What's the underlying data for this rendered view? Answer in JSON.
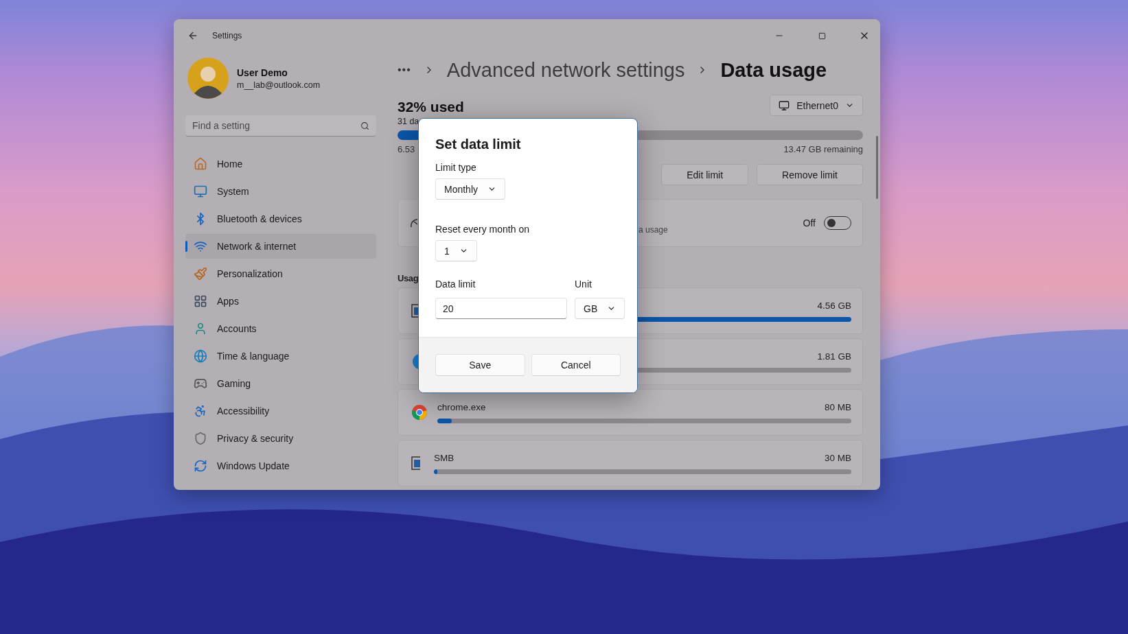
{
  "window": {
    "title": "Settings"
  },
  "profile": {
    "name": "User Demo",
    "email": "m__lab@outlook.com"
  },
  "search": {
    "placeholder": "Find a setting"
  },
  "sidebar": {
    "items": [
      {
        "label": "Home",
        "kind": "home",
        "selected": false
      },
      {
        "label": "System",
        "kind": "system",
        "selected": false
      },
      {
        "label": "Bluetooth & devices",
        "kind": "bluetooth",
        "selected": false
      },
      {
        "label": "Network & internet",
        "kind": "network",
        "selected": true
      },
      {
        "label": "Personalization",
        "kind": "brush",
        "selected": false
      },
      {
        "label": "Apps",
        "kind": "apps",
        "selected": false
      },
      {
        "label": "Accounts",
        "kind": "accounts",
        "selected": false
      },
      {
        "label": "Time & language",
        "kind": "time",
        "selected": false
      },
      {
        "label": "Gaming",
        "kind": "gaming",
        "selected": false
      },
      {
        "label": "Accessibility",
        "kind": "accessibility",
        "selected": false
      },
      {
        "label": "Privacy & security",
        "kind": "privacy",
        "selected": false
      },
      {
        "label": "Windows Update",
        "kind": "update",
        "selected": false
      }
    ]
  },
  "breadcrumb": {
    "more": "•••",
    "parent": "Advanced network settings",
    "current": "Data usage"
  },
  "network_select": {
    "value": "Ethernet0"
  },
  "usage_summary": {
    "title": "32% used",
    "subtitle": "31 da",
    "used": "6.53",
    "remaining": "13.47 GB remaining",
    "level": 0.32
  },
  "limit_buttons": [
    "Edit limit",
    "Remove limit"
  ],
  "metered_card": {
    "description": "a usage",
    "state_label": "Off",
    "on": false
  },
  "usage_heading": "Usag",
  "apps": [
    {
      "kind": "window",
      "value": "4.56 GB",
      "level": 1
    },
    {
      "kind": "edge",
      "value": "1.81 GB",
      "level": 0.4
    },
    {
      "kind": "chrome",
      "name": "chrome.exe",
      "value": "80 MB",
      "level": 0.035
    },
    {
      "kind": "window",
      "name": "SMB",
      "value": "30 MB",
      "level": 0.008
    }
  ],
  "dialog": {
    "title": "Set data limit",
    "limit_type": {
      "label": "Limit type",
      "value": "Monthly"
    },
    "reset_day": {
      "label": "Reset every month on",
      "value": "1"
    },
    "data_limit": {
      "label": "Data limit",
      "value": "20"
    },
    "unit": {
      "label": "Unit",
      "value": "GB"
    },
    "buttons": [
      "Save",
      "Cancel"
    ]
  }
}
